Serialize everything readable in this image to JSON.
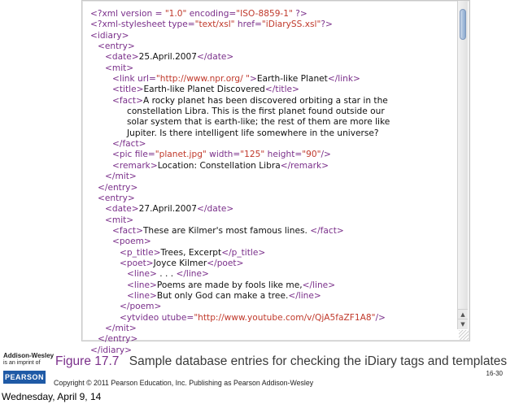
{
  "code_lines": [
    {
      "indent": 0,
      "parts": [
        [
          "tag",
          "<?xml version = "
        ],
        [
          "val",
          "\"1.0\""
        ],
        [
          "tag",
          " encoding="
        ],
        [
          "val",
          "\"ISO-8859-1\""
        ],
        [
          "tag",
          " ?>"
        ]
      ]
    },
    {
      "indent": 0,
      "parts": [
        [
          "tag",
          "<?xml-stylesheet type="
        ],
        [
          "val",
          "\"text/xsl\""
        ],
        [
          "tag",
          " href="
        ],
        [
          "val",
          "\"iDiarySS.xsl\""
        ],
        [
          "tag",
          "?>"
        ]
      ]
    },
    {
      "indent": 0,
      "parts": [
        [
          "tag",
          "<idiary>"
        ]
      ]
    },
    {
      "indent": 1,
      "parts": [
        [
          "tag",
          "<entry>"
        ]
      ]
    },
    {
      "indent": 2,
      "parts": [
        [
          "tag",
          "<date>"
        ],
        [
          "txt",
          "25.April.2007"
        ],
        [
          "tag",
          "</date>"
        ]
      ]
    },
    {
      "indent": 2,
      "parts": [
        [
          "tag",
          "<mit>"
        ]
      ]
    },
    {
      "indent": 3,
      "parts": [
        [
          "tag",
          "<link url="
        ],
        [
          "val",
          "\"http://www.npr.org/ \""
        ],
        [
          "tag",
          ">"
        ],
        [
          "txt",
          "Earth-like Planet"
        ],
        [
          "tag",
          "</link>"
        ]
      ]
    },
    {
      "indent": 3,
      "parts": [
        [
          "tag",
          "<title>"
        ],
        [
          "txt",
          "Earth-like Planet Discovered"
        ],
        [
          "tag",
          "</title>"
        ]
      ]
    },
    {
      "indent": 3,
      "parts": [
        [
          "tag",
          "<fact>"
        ],
        [
          "txt",
          "A rocky planet has been discovered orbiting a star in the"
        ]
      ]
    },
    {
      "indent": 5,
      "parts": [
        [
          "txt",
          "constellation Libra. This is the first planet found outside our"
        ]
      ]
    },
    {
      "indent": 5,
      "parts": [
        [
          "txt",
          "solar system that is earth-like; the rest of them are more like"
        ]
      ]
    },
    {
      "indent": 5,
      "parts": [
        [
          "txt",
          "Jupiter. Is there intelligent life somewhere in the universe?"
        ]
      ]
    },
    {
      "indent": 3,
      "parts": [
        [
          "tag",
          "</fact>"
        ]
      ]
    },
    {
      "indent": 3,
      "parts": [
        [
          "tag",
          "<pic file="
        ],
        [
          "val",
          "\"planet.jpg\""
        ],
        [
          "tag",
          " width="
        ],
        [
          "val",
          "\"125\""
        ],
        [
          "tag",
          " height="
        ],
        [
          "val",
          "\"90\""
        ],
        [
          "tag",
          "/>"
        ]
      ]
    },
    {
      "indent": 3,
      "parts": [
        [
          "tag",
          "<remark>"
        ],
        [
          "txt",
          "Location: Constellation Libra"
        ],
        [
          "tag",
          "</remark>"
        ]
      ]
    },
    {
      "indent": 2,
      "parts": [
        [
          "tag",
          "</mit>"
        ]
      ]
    },
    {
      "indent": 1,
      "parts": [
        [
          "tag",
          "</entry>"
        ]
      ]
    },
    {
      "indent": 1,
      "parts": [
        [
          "tag",
          "<entry>"
        ]
      ]
    },
    {
      "indent": 2,
      "parts": [
        [
          "tag",
          "<date>"
        ],
        [
          "txt",
          "27.April.2007"
        ],
        [
          "tag",
          "</date>"
        ]
      ]
    },
    {
      "indent": 2,
      "parts": [
        [
          "tag",
          "<mit>"
        ]
      ]
    },
    {
      "indent": 3,
      "parts": [
        [
          "tag",
          "<fact>"
        ],
        [
          "txt",
          "These are Kilmer's most famous lines. "
        ],
        [
          "tag",
          "</fact>"
        ]
      ]
    },
    {
      "indent": 3,
      "parts": [
        [
          "tag",
          "<poem>"
        ]
      ]
    },
    {
      "indent": 4,
      "parts": [
        [
          "tag",
          "<p_title>"
        ],
        [
          "txt",
          "Trees, Excerpt"
        ],
        [
          "tag",
          "</p_title>"
        ]
      ]
    },
    {
      "indent": 4,
      "parts": [
        [
          "tag",
          "<poet>"
        ],
        [
          "txt",
          "Joyce Kilmer"
        ],
        [
          "tag",
          "</poet>"
        ]
      ]
    },
    {
      "indent": 5,
      "parts": [
        [
          "tag",
          "<line>"
        ],
        [
          "txt",
          " . . . "
        ],
        [
          "tag",
          "</line>"
        ]
      ]
    },
    {
      "indent": 5,
      "parts": [
        [
          "tag",
          "<line>"
        ],
        [
          "txt",
          "Poems are made by fools like me,"
        ],
        [
          "tag",
          "</line>"
        ]
      ]
    },
    {
      "indent": 5,
      "parts": [
        [
          "tag",
          "<line>"
        ],
        [
          "txt",
          "But only God can make a tree."
        ],
        [
          "tag",
          "</line>"
        ]
      ]
    },
    {
      "indent": 4,
      "parts": [
        [
          "tag",
          "</poem>"
        ]
      ]
    },
    {
      "indent": 4,
      "parts": [
        [
          "tag",
          "<ytvideo utube="
        ],
        [
          "val",
          "\"http://www.youtube.com/v/QjA5faZF1A8\""
        ],
        [
          "tag",
          "/>"
        ]
      ]
    },
    {
      "indent": 2,
      "parts": [
        [
          "tag",
          "</mit>"
        ]
      ]
    },
    {
      "indent": 1,
      "parts": [
        [
          "tag",
          "</entry>"
        ]
      ]
    },
    {
      "indent": 0,
      "parts": [
        [
          "tag",
          "</idiary>"
        ]
      ]
    }
  ],
  "caption": {
    "figure_number": "Figure 17.7",
    "text": "Sample database entries for checking the iDiary tags and templates"
  },
  "footer": {
    "publisher_name": "Addison-Wesley",
    "publisher_imprint": "is an imprint of",
    "pearson_logo": "PEARSON",
    "copyright": "Copyright © 2011 Pearson Education, Inc. Publishing as Pearson Addison-Wesley",
    "slide_number": "16-30",
    "date": "Wednesday, April 9, 14"
  },
  "colors": {
    "tag": "#7a2f8a",
    "value": "#c0392b",
    "text": "#111111",
    "pearson_blue": "#1f5aa6"
  }
}
